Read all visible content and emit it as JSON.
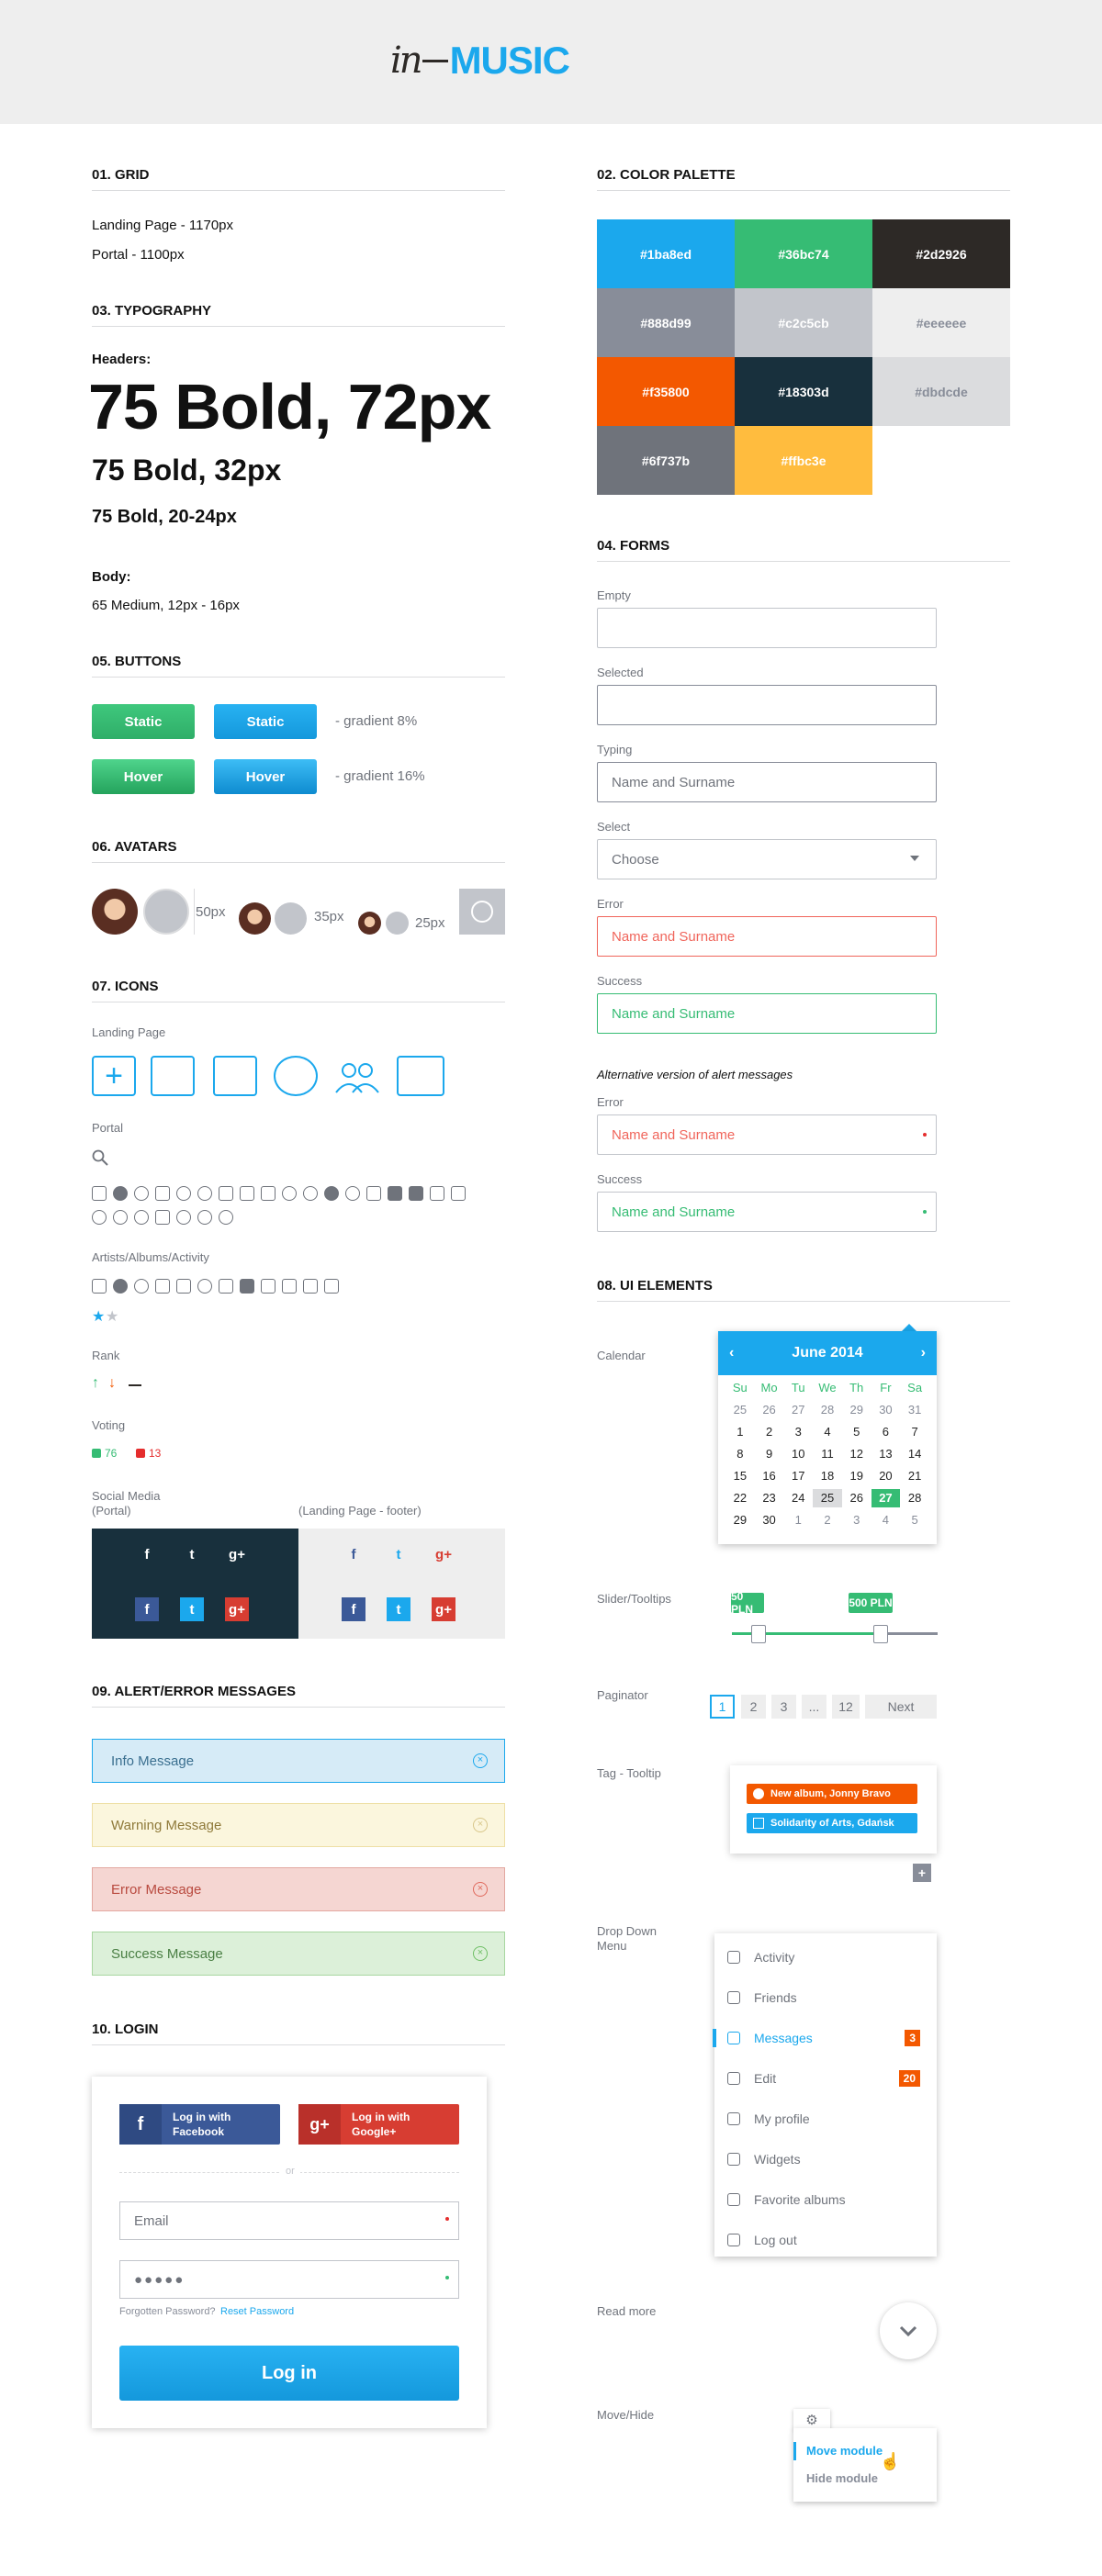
{
  "logo": {
    "script": "in",
    "music": "MUSIC"
  },
  "grid": {
    "title": "01. GRID",
    "landing": "Landing Page - 1170px",
    "portal": "Portal - 1100px"
  },
  "palette": {
    "title": "02. COLOR PALETTE",
    "colors": [
      "#1ba8ed",
      "#36bc74",
      "#2d2926",
      "#888d99",
      "#c2c5cb",
      "#eeeeee",
      "#f35800",
      "#18303d",
      "#dbdcde",
      "#6f737b",
      "#ffbc3e"
    ],
    "labels": [
      "#1ba8ed",
      "#36bc74",
      "#2d2926",
      "#888d99",
      "#c2c5cb",
      "#eeeeee",
      "#f35800",
      "#18303d",
      "#dbdcde",
      "#6f737b",
      "#ffbc3e"
    ]
  },
  "typography": {
    "title": "03. TYPOGRAPHY",
    "headers": "Headers:",
    "h1": "75 Bold, 72px",
    "h2": "75 Bold, 32px",
    "h3": "75 Bold, 20-24px",
    "body": "Body:",
    "body_text": "65 Medium, 12px - 16px"
  },
  "forms": {
    "title": "04. FORMS",
    "empty": "Empty",
    "selected": "Selected",
    "typing": "Typing",
    "typing_value": "Name and Surname",
    "select": "Select",
    "select_value": "Choose",
    "error": "Error",
    "error_value": "Name and Surname",
    "success": "Success",
    "success_value": "Name and Surname",
    "alt_title": "Alternative version of alert messages",
    "alt_error": "Error",
    "alt_error_value": "Name and Surname",
    "alt_success": "Success",
    "alt_success_value": "Name and Surname"
  },
  "buttons": {
    "title": "05. BUTTONS",
    "static1": "Static",
    "static2": "Static",
    "static_note": "- gradient 8%",
    "hover1": "Hover",
    "hover2": "Hover",
    "hover_note": "- gradient 16%"
  },
  "avatars": {
    "title": "06. AVATARS",
    "s50": "50px",
    "s35": "35px",
    "s25": "25px"
  },
  "icons": {
    "title": "07. ICONS",
    "landing": "Landing Page",
    "portal": "Portal",
    "artists": "Artists/Albums/Activity",
    "rank": "Rank",
    "voting": "Voting",
    "up": "76",
    "down": "13",
    "social": "Social Media",
    "social_sub": "(Portal)",
    "social_footer": "(Landing Page - footer)"
  },
  "ui": {
    "title": "08. UI ELEMENTS",
    "calendar": "Calendar",
    "month": "June 2014",
    "weekdays": [
      "Su",
      "Mo",
      "Tu",
      "We",
      "Th",
      "Fr",
      "Sa"
    ],
    "days": [
      "25",
      "26",
      "27",
      "28",
      "29",
      "30",
      "31",
      "1",
      "2",
      "3",
      "4",
      "5",
      "6",
      "7",
      "8",
      "9",
      "10",
      "11",
      "12",
      "13",
      "14",
      "15",
      "16",
      "17",
      "18",
      "19",
      "20",
      "21",
      "22",
      "23",
      "24",
      "25",
      "26",
      "27",
      "28",
      "29",
      "30",
      "1",
      "2",
      "3",
      "4",
      "5"
    ],
    "slider": "Slider/Tooltips",
    "tip1": "50 PLN",
    "tip2": "500 PLN",
    "paginator": "Paginator",
    "pages": [
      "1",
      "2",
      "3",
      "...",
      "12"
    ],
    "next": "Next",
    "tag": "Tag - Tooltip",
    "tag1": "New album, Jonny Bravo",
    "tag2": "Solidarity of Arts, Gdańsk",
    "plus": "+",
    "dropdown": "Drop Down",
    "dropdown2": "Menu",
    "menu": [
      {
        "label": "Activity",
        "badge": ""
      },
      {
        "label": "Friends",
        "badge": ""
      },
      {
        "label": "Messages",
        "badge": "3"
      },
      {
        "label": "Edit",
        "badge": "20"
      },
      {
        "label": "My profile",
        "badge": ""
      },
      {
        "label": "Widgets",
        "badge": ""
      },
      {
        "label": "Favorite albums",
        "badge": ""
      },
      {
        "label": "Log out",
        "badge": ""
      }
    ],
    "readmore": "Read more",
    "movehide": "Move/Hide",
    "move": "Move module",
    "hide": "Hide module"
  },
  "alerts": {
    "title": "09. ALERT/ERROR MESSAGES",
    "info": "Info Message",
    "warning": "Warning Message",
    "error": "Error Message",
    "success": "Success Message"
  },
  "login": {
    "title": "10. LOGIN",
    "fb1": "Log in with",
    "fb2": "Facebook",
    "gp1": "Log in with",
    "gp2": "Google+",
    "or": "or",
    "email": "Email",
    "password": "●●●●●",
    "forgot": "Forgotten Password?",
    "reset": "Reset Password",
    "button": "Log in"
  }
}
